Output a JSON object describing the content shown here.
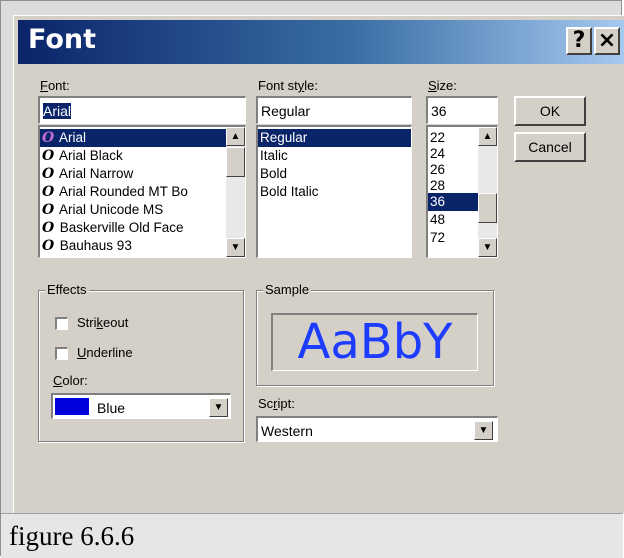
{
  "dialog": {
    "title": "Font",
    "help_button": "?",
    "close_button": "×"
  },
  "font": {
    "label_underline": "F",
    "label_rest": "ont:",
    "value": "Arial",
    "items": [
      "Arial",
      "Arial Black",
      "Arial Narrow",
      "Arial Rounded MT Bo",
      "Arial Unicode MS",
      "Baskerville Old Face",
      "Bauhaus 93"
    ],
    "icon_glyph": "O"
  },
  "style": {
    "label_pre": "Font st",
    "label_underline": "y",
    "label_post": "le:",
    "value": "Regular",
    "items": [
      "Regular",
      "Italic",
      "Bold",
      "Bold Italic"
    ]
  },
  "size": {
    "label_underline": "S",
    "label_rest": "ize:",
    "value": "36",
    "items": [
      "22",
      "24",
      "26",
      "28",
      "36",
      "48",
      "72"
    ]
  },
  "buttons": {
    "ok": "OK",
    "cancel": "Cancel"
  },
  "effects": {
    "group_label": "Effects",
    "strikeout_underline": "k",
    "strikeout_pre": "Stri",
    "strikeout_post": "eout",
    "underline_underline": "U",
    "underline_rest": "nderline",
    "color_underline": "C",
    "color_rest": "olor:",
    "color_value": "Blue",
    "color_hex": "#0000dd"
  },
  "sample": {
    "group_label": "Sample",
    "text": "AaBbY",
    "text_color": "#1e3cff"
  },
  "script": {
    "label_pre": "Sc",
    "label_underline": "r",
    "label_post": "ipt:",
    "value": "Western"
  },
  "caption": "figure 6.6.6",
  "icons": {
    "scroll_up": "up-arrow-icon",
    "scroll_down": "down-arrow-icon",
    "font_type": "opentype-font-icon"
  },
  "colors": {
    "selection": "#0a246a",
    "dialog_face": "#d4d0c8"
  }
}
